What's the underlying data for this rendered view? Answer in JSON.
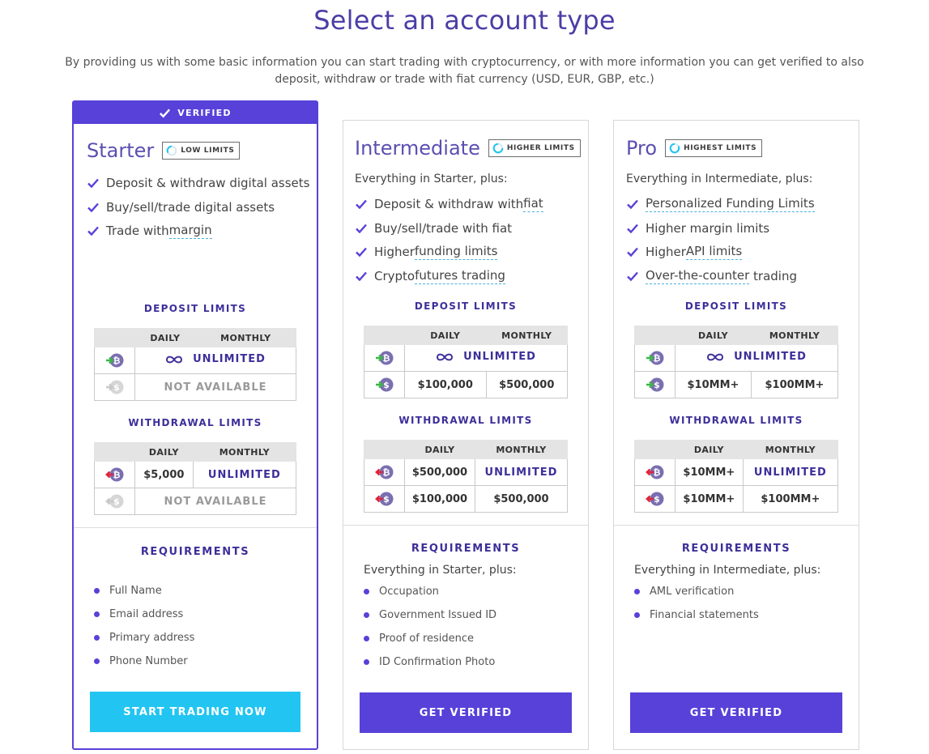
{
  "page": {
    "title": "Select an account type",
    "intro": "By providing us with some basic information you can start trading with cryptocurrency, or with more information you can get verified to also deposit, withdraw or trade with fiat currency (USD, EUR, GBP, etc.)"
  },
  "colors": {
    "brand": "#5741d9",
    "heading": "#3d2f9a",
    "cyan": "#22c5f1",
    "deposit_arrow": "#3cb54a",
    "withdraw_arrow": "#e0243a",
    "coin": "#7a6fb0"
  },
  "labels": {
    "deposit_limits": "DEPOSIT LIMITS",
    "withdrawal_limits": "WITHDRAWAL LIMITS",
    "requirements": "REQUIREMENTS",
    "daily": "DAILY",
    "monthly": "MONTHLY",
    "unlimited": "UNLIMITED",
    "not_available": "NOT AVAILABLE"
  },
  "starter": {
    "ribbon": "VERIFIED",
    "title": "Starter",
    "badge": "LOW LIMITS",
    "features": [
      {
        "text": "Deposit & withdraw digital assets"
      },
      {
        "text": "Buy/sell/trade digital assets"
      },
      {
        "pre": "Trade with ",
        "term": "margin"
      }
    ],
    "deposit": {
      "crypto_unlimited": true,
      "fiat": "NOT AVAILABLE"
    },
    "withdrawal": {
      "crypto_daily": "$5,000",
      "crypto_monthly": "UNLIMITED",
      "fiat": "NOT AVAILABLE"
    },
    "requirements": [
      "Full Name",
      "Email address",
      "Primary address",
      "Phone Number"
    ],
    "cta": "START TRADING NOW"
  },
  "intermediate": {
    "title": "Intermediate",
    "badge": "HIGHER LIMITS",
    "subhead": "Everything in Starter, plus:",
    "features": [
      {
        "pre": "Deposit & withdraw with ",
        "term": "fiat"
      },
      {
        "text": "Buy/sell/trade with fiat"
      },
      {
        "pre": "Higher ",
        "term": "funding limits"
      },
      {
        "pre": "Crypto ",
        "term": "futures trading"
      }
    ],
    "deposit": {
      "fiat_daily": "$100,000",
      "fiat_monthly": "$500,000"
    },
    "withdrawal": {
      "crypto_daily": "$500,000",
      "crypto_monthly": "UNLIMITED",
      "fiat_daily": "$100,000",
      "fiat_monthly": "$500,000"
    },
    "req_subhead": "Everything in Starter, plus:",
    "requirements": [
      "Occupation",
      "Government Issued ID",
      "Proof of residence",
      "ID Confirmation Photo"
    ],
    "cta": "GET VERIFIED"
  },
  "pro": {
    "title": "Pro",
    "badge": "HIGHEST LIMITS",
    "subhead": "Everything in Intermediate, plus:",
    "features": [
      {
        "term": "Personalized Funding Limits"
      },
      {
        "text": "Higher margin limits"
      },
      {
        "pre": "Higher ",
        "term": "API limits"
      },
      {
        "term": "Over-the-counter",
        "post": " trading"
      }
    ],
    "deposit": {
      "fiat_daily": "$10MM+",
      "fiat_monthly": "$100MM+"
    },
    "withdrawal": {
      "crypto_daily": "$10MM+",
      "crypto_monthly": "UNLIMITED",
      "fiat_daily": "$10MM+",
      "fiat_monthly": "$100MM+"
    },
    "req_subhead": "Everything in Intermediate, plus:",
    "requirements": [
      "AML verification",
      "Financial statements"
    ],
    "cta": "GET VERIFIED"
  }
}
